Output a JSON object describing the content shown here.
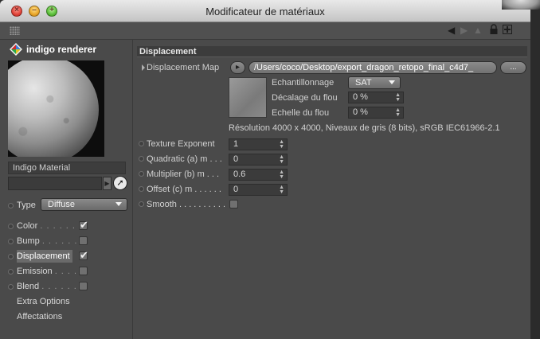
{
  "window": {
    "title": "Modificateur de matériaux"
  },
  "toolbar": {
    "icons": [
      "back-arrow-icon",
      "forward-arrow-icon",
      "up-arrow-icon",
      "lock-icon",
      "new-window-icon"
    ]
  },
  "sidebar": {
    "brand": "indigo renderer",
    "material_name": "Indigo Material",
    "type_label": "Type",
    "type_value": "Diffuse",
    "channels": [
      {
        "label": "Color",
        "dots": ". . . . . . .",
        "checked": true
      },
      {
        "label": "Bump",
        "dots": ". . . . . .",
        "checked": false
      },
      {
        "label": "Displacement",
        "dots": "",
        "checked": true
      },
      {
        "label": "Emission",
        "dots": ". . . .",
        "checked": false
      },
      {
        "label": "Blend",
        "dots": ". . . . . . .",
        "checked": false
      }
    ],
    "extra_options": "Extra Options",
    "affectations": "Affectations"
  },
  "displacement": {
    "section_title": "Displacement",
    "map_label": "Displacement Map",
    "map_path": "/Users/coco/Desktop/export_dragon_retopo_final_c4d7_",
    "browse_label": "...",
    "sampling_label": "Echantillonnage",
    "sampling_value": "SAT",
    "blur_offset_label": "Décalage du flou",
    "blur_offset_value": "0 %",
    "blur_scale_label": "Echelle du flou",
    "blur_scale_value": "0 %",
    "resolution_info": "Résolution 4000 x 4000, Niveaux de gris (8 bits), sRGB IEC61966-2.1",
    "params": [
      {
        "label": "Texture Exponent",
        "value": "1"
      },
      {
        "label": "Quadratic (a) m . . .",
        "value": "0"
      },
      {
        "label": "Multiplier (b) m . . .",
        "value": "0.6"
      },
      {
        "label": "Offset (c) m . . . . . .",
        "value": "0"
      }
    ],
    "smooth_label": "Smooth . . . . . . . . . .",
    "smooth_checked": false
  }
}
